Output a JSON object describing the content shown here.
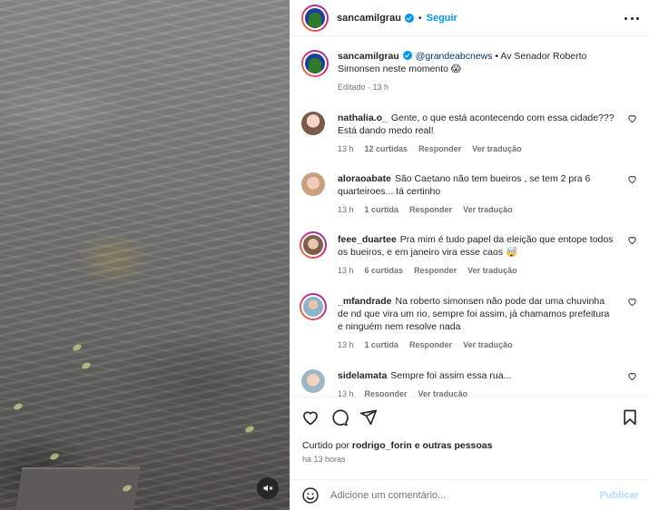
{
  "post": {
    "author": "sancamilgrau",
    "follow_label": "Seguir",
    "caption_mention": "@grandeabcnews",
    "caption_text": " • Av Senador Roberto Simonsen neste momento 😱",
    "caption_meta": "Editado · 13 h"
  },
  "comments": [
    {
      "user": "nathalia.o_",
      "text": "Gente, o que está acontecendo com essa cidade??? Está dando medo real!",
      "time": "13 h",
      "likes": "12 curtidas",
      "reply": "Responder",
      "translate": "Ver tradução",
      "avatar_color": "#c9a48a"
    },
    {
      "user": "aloraoabate",
      "text": "São Caetano não tem bueiros , se tem 2 pra 6 quarteiroes... tá certinho",
      "time": "13 h",
      "likes": "1 curtida",
      "reply": "Responder",
      "translate": "Ver tradução",
      "avatar_color": "#d9b39a"
    },
    {
      "user": "feee_duartee",
      "text": "Pra mim é tudo papel da eleição que entope todos os bueiros, e em janeiro vira esse caos 🤯",
      "time": "13 h",
      "likes": "6 curtidas",
      "reply": "Responder",
      "translate": "Ver tradução",
      "avatar_color": "#b89a80"
    },
    {
      "user": "_mfandrade",
      "text": "Na roberto simonsen não pode dar uma chuvinha de nd que vira um rio, sempre foi assim, já chamamos prefeitura e ninguém nem resolve nada",
      "time": "13 h",
      "likes": "1 curtida",
      "reply": "Responder",
      "translate": "Ver tradução",
      "avatar_color": "#8fb3c9"
    },
    {
      "user": "sidelamata",
      "text": "Sempre foi assim essa rua...",
      "time": "13 h",
      "likes": "Responder",
      "reply": "Ver tradução",
      "translate": "",
      "avatar_color": "#9fb7c4"
    }
  ],
  "footer": {
    "liked_by_prefix": "Curtido por ",
    "liked_by_user": "rodrigo_forin",
    "liked_by_suffix": " e outras pessoas",
    "ago": "há 13 horas",
    "comment_placeholder": "Adicione um comentário...",
    "publish_label": "Publicar"
  },
  "colors": {
    "accent": "#0095f6",
    "publish_disabled": "#b2dffc"
  }
}
